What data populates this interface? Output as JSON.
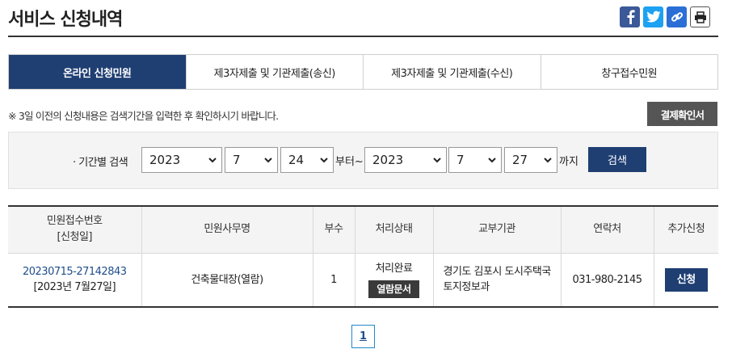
{
  "page": {
    "title": "서비스 신청내역"
  },
  "share": {
    "facebook_icon": "facebook-icon",
    "twitter_icon": "twitter-icon",
    "link_icon": "link-icon",
    "print_icon": "print-icon"
  },
  "tabs": [
    {
      "label": "온라인 신청민원",
      "active": true
    },
    {
      "label": "제3자제출 및 기관제출(송신)",
      "active": false
    },
    {
      "label": "제3자제출 및 기관제출(수신)",
      "active": false
    },
    {
      "label": "창구접수민원",
      "active": false
    }
  ],
  "notice": "※ 3일 이전의 신청내용은 검색기간을 입력한 후 확인하시기 바랍니다.",
  "confirm_button": "결제확인서",
  "search": {
    "label": "· 기간별 검색",
    "from": {
      "year": "2023",
      "month": "7",
      "day": "24"
    },
    "from_word": "부터~",
    "to": {
      "year": "2023",
      "month": "7",
      "day": "27"
    },
    "to_word": "까지",
    "button": "검색"
  },
  "table": {
    "headers": {
      "receipt_no": "민원접수번호",
      "receipt_date": "[신청일]",
      "office_name": "민원사무명",
      "copies": "부수",
      "status": "처리상태",
      "agency": "교부기관",
      "contact": "연락처",
      "additional": "추가신청"
    },
    "rows": [
      {
        "receipt_no": "20230715-27142843",
        "receipt_date": "[2023년 7월27일]",
        "office_name": "건축물대장(열람)",
        "copies": "1",
        "status": "처리완료",
        "status_button": "열람문서",
        "agency": "경기도 김포시 도시주택국 토지정보과",
        "contact": "031-980-2145",
        "apply_button": "신청"
      }
    ]
  },
  "pagination": {
    "current": "1"
  },
  "colors": {
    "brand_navy": "#1f3f73",
    "dark_gray": "#555555",
    "link_blue": "#1f4e8c"
  }
}
